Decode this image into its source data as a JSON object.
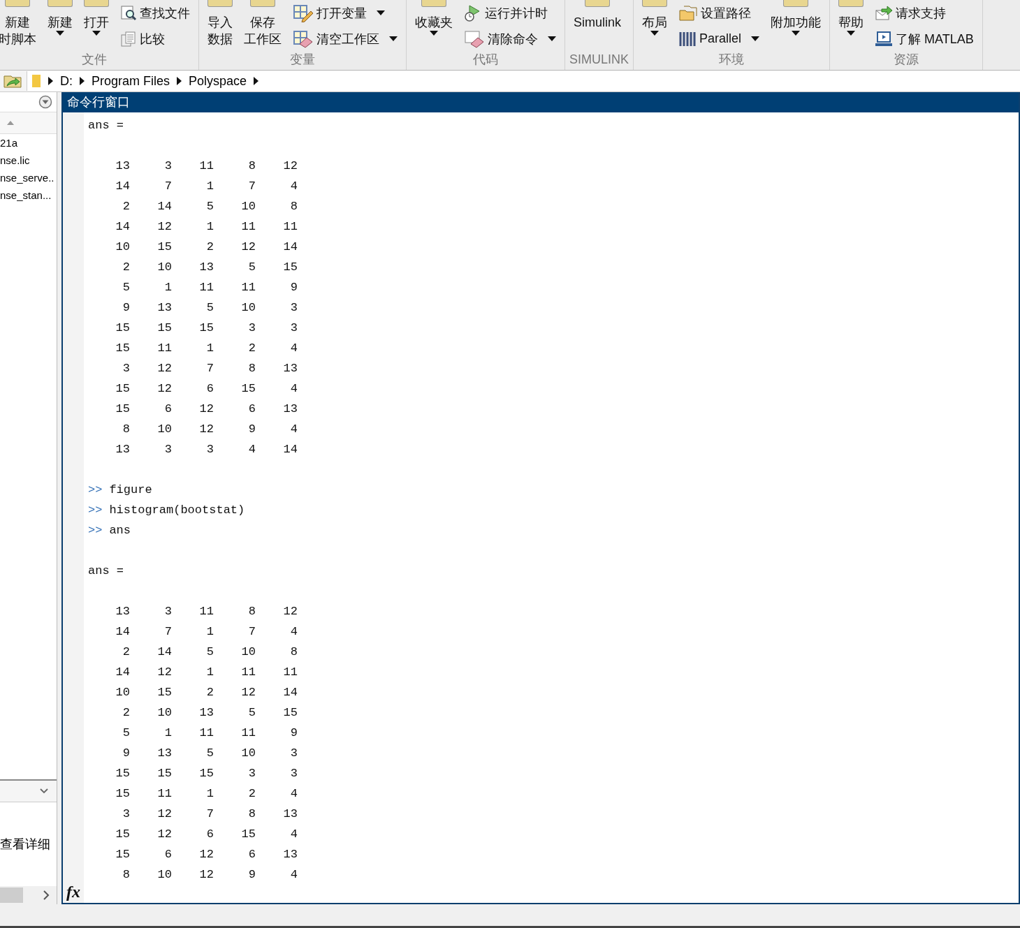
{
  "toolbar": {
    "groups": [
      {
        "label": "文件",
        "items": [
          {
            "kind": "large",
            "lines": [
              "新建",
              "时脚本"
            ],
            "has_menu": false
          },
          {
            "kind": "large",
            "lines": [
              "新建"
            ],
            "has_menu": true
          },
          {
            "kind": "large",
            "lines": [
              "打开"
            ],
            "has_menu": true
          },
          {
            "kind": "stack",
            "entries": [
              {
                "label": "查找文件",
                "has_menu": false
              },
              {
                "label": "比较",
                "has_menu": false
              }
            ]
          }
        ]
      },
      {
        "label": "变量",
        "items": [
          {
            "kind": "large",
            "lines": [
              "导入",
              "数据"
            ],
            "has_menu": false
          },
          {
            "kind": "large",
            "lines": [
              "保存",
              "工作区"
            ],
            "has_menu": false
          },
          {
            "kind": "stack",
            "entries": [
              {
                "label": "打开变量",
                "has_menu": true
              },
              {
                "label": "清空工作区",
                "has_menu": true
              }
            ]
          }
        ]
      },
      {
        "label": "代码",
        "items": [
          {
            "kind": "large",
            "lines": [
              "收藏夹"
            ],
            "has_menu": true
          },
          {
            "kind": "stack",
            "entries": [
              {
                "label": "运行并计时",
                "has_menu": false
              },
              {
                "label": "清除命令",
                "has_menu": true
              }
            ]
          }
        ]
      },
      {
        "label": "SIMULINK",
        "items": [
          {
            "kind": "large",
            "lines": [
              "Simulink"
            ],
            "has_menu": false
          }
        ]
      },
      {
        "label": "环境",
        "items": [
          {
            "kind": "large",
            "lines": [
              "布局"
            ],
            "has_menu": true
          },
          {
            "kind": "stack",
            "entries": [
              {
                "label": "设置路径",
                "has_menu": false
              },
              {
                "label": "Parallel",
                "has_menu": true
              }
            ]
          },
          {
            "kind": "large",
            "lines": [
              "附加功能"
            ],
            "has_menu": true
          }
        ]
      },
      {
        "label": "资源",
        "items": [
          {
            "kind": "large",
            "lines": [
              "帮助"
            ],
            "has_menu": true
          },
          {
            "kind": "stack",
            "entries": [
              {
                "label": "请求支持",
                "has_menu": false
              },
              {
                "label": "了解 MATLAB",
                "has_menu": false
              }
            ]
          }
        ]
      }
    ]
  },
  "address_bar": {
    "path": [
      "D:",
      "Program Files",
      "Polyspace"
    ]
  },
  "file_panel": {
    "files": [
      "21a",
      "nse.lic",
      "nse_serve..",
      "nse_stan..."
    ],
    "details_text": "查看详细"
  },
  "command_window": {
    "title": "命令行窗口",
    "lines": [
      {
        "kind": "output",
        "text": "ans ="
      },
      {
        "kind": "blank"
      },
      {
        "kind": "matrix",
        "rows": [
          [
            "13",
            "3",
            "11",
            "8",
            "12"
          ],
          [
            "14",
            "7",
            "1",
            "7",
            "4"
          ],
          [
            "2",
            "14",
            "5",
            "10",
            "8"
          ],
          [
            "14",
            "12",
            "1",
            "11",
            "11"
          ],
          [
            "10",
            "15",
            "2",
            "12",
            "14"
          ],
          [
            "2",
            "10",
            "13",
            "5",
            "15"
          ],
          [
            "5",
            "1",
            "11",
            "11",
            "9"
          ],
          [
            "9",
            "13",
            "5",
            "10",
            "3"
          ],
          [
            "15",
            "15",
            "15",
            "3",
            "3"
          ],
          [
            "15",
            "11",
            "1",
            "2",
            "4"
          ],
          [
            "3",
            "12",
            "7",
            "8",
            "13"
          ],
          [
            "15",
            "12",
            "6",
            "15",
            "4"
          ],
          [
            "15",
            "6",
            "12",
            "6",
            "13"
          ],
          [
            "8",
            "10",
            "12",
            "9",
            "4"
          ],
          [
            "13",
            "3",
            "3",
            "4",
            "14"
          ]
        ]
      },
      {
        "kind": "blank"
      },
      {
        "kind": "prompt",
        "prompt": ">>",
        "text": "figure"
      },
      {
        "kind": "prompt",
        "prompt": ">>",
        "text": "histogram(bootstat)"
      },
      {
        "kind": "prompt",
        "prompt": ">>",
        "text": "ans"
      },
      {
        "kind": "blank"
      },
      {
        "kind": "output",
        "text": "ans ="
      },
      {
        "kind": "blank"
      },
      {
        "kind": "matrix",
        "rows": [
          [
            "13",
            "3",
            "11",
            "8",
            "12"
          ],
          [
            "14",
            "7",
            "1",
            "7",
            "4"
          ],
          [
            "2",
            "14",
            "5",
            "10",
            "8"
          ],
          [
            "14",
            "12",
            "1",
            "11",
            "11"
          ],
          [
            "10",
            "15",
            "2",
            "12",
            "14"
          ],
          [
            "2",
            "10",
            "13",
            "5",
            "15"
          ],
          [
            "5",
            "1",
            "11",
            "11",
            "9"
          ],
          [
            "9",
            "13",
            "5",
            "10",
            "3"
          ],
          [
            "15",
            "15",
            "15",
            "3",
            "3"
          ],
          [
            "15",
            "11",
            "1",
            "2",
            "4"
          ],
          [
            "3",
            "12",
            "7",
            "8",
            "13"
          ],
          [
            "15",
            "12",
            "6",
            "15",
            "4"
          ],
          [
            "15",
            "6",
            "12",
            "6",
            "13"
          ],
          [
            "8",
            "10",
            "12",
            "9",
            "4"
          ]
        ]
      }
    ],
    "function_hint": "fx"
  }
}
